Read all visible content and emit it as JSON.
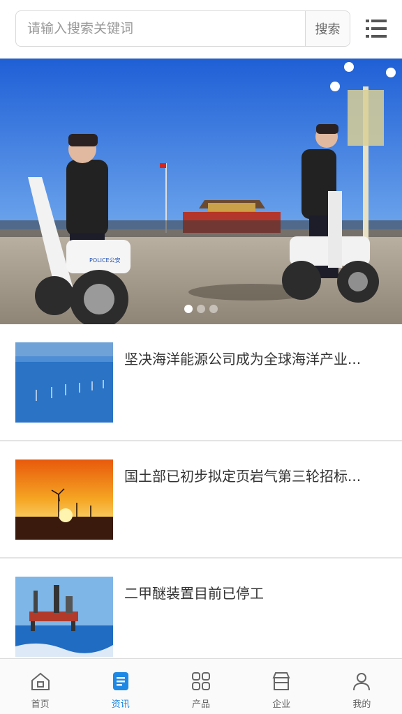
{
  "search": {
    "placeholder": "请输入搜索关键词",
    "button_label": "搜索"
  },
  "menu": {
    "icon": "menu-icon"
  },
  "banner": {
    "slide_count": 3,
    "active_index": 0,
    "police_label": "POLICE公安"
  },
  "news": [
    {
      "title": "坚决海洋能源公司成为全球海洋产业...",
      "thumb": "offshore-wind-farm"
    },
    {
      "title": "国土部已初步拟定页岩气第三轮招标...",
      "thumb": "wind-turbine-sunset"
    },
    {
      "title": "二甲醚装置目前已停工",
      "thumb": "offshore-oil-rig"
    }
  ],
  "tabbar": {
    "items": [
      {
        "label": "首页",
        "icon": "home-icon"
      },
      {
        "label": "资讯",
        "icon": "news-icon",
        "active": true
      },
      {
        "label": "产品",
        "icon": "grid-icon"
      },
      {
        "label": "企业",
        "icon": "store-icon"
      },
      {
        "label": "我的",
        "icon": "user-icon"
      }
    ]
  },
  "colors": {
    "accent": "#1e88e5",
    "sky": "#2f6fd8",
    "text": "#333333"
  }
}
